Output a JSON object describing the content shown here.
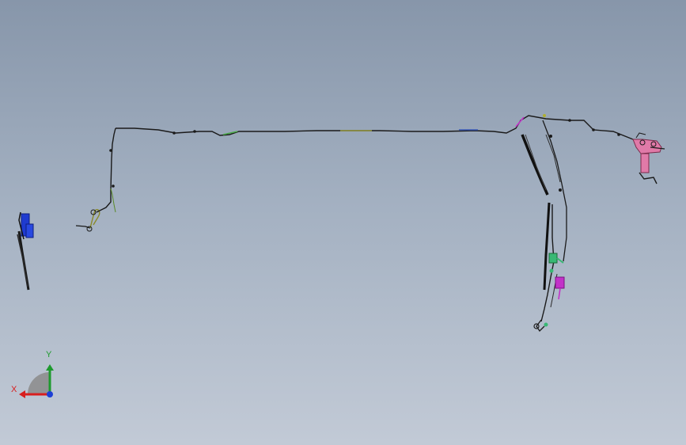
{
  "viewport": {
    "background_top": "#8796aa",
    "background_bottom": "#c2cad6"
  },
  "triad": {
    "x_label": "X",
    "y_label": "Y",
    "x_color": "#d81e1e",
    "y_color": "#1e9a2e",
    "z_color": "#1d3fd6"
  },
  "model": {
    "parts": [
      {
        "name": "left-bracket",
        "color": "#1f3bd0"
      },
      {
        "name": "main-harness-run",
        "color": "#1a1a1a"
      },
      {
        "name": "right-vertical-assembly",
        "color": "#1a1a1a"
      },
      {
        "name": "connector-green",
        "color": "#38b874"
      },
      {
        "name": "connector-magenta",
        "color": "#c232c8"
      },
      {
        "name": "right-mount-pink",
        "color": "#e07aa8"
      }
    ]
  }
}
